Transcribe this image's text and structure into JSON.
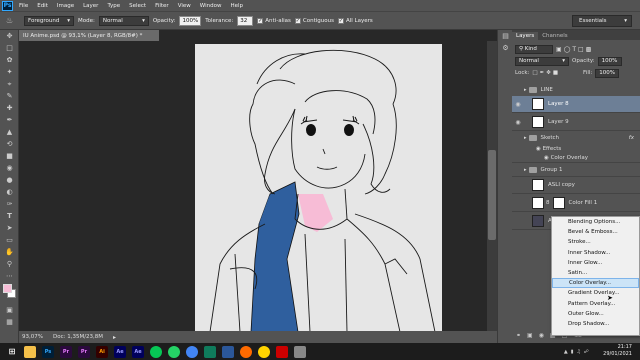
{
  "app": {
    "logo": "Ps"
  },
  "menu": [
    "File",
    "Edit",
    "Image",
    "Layer",
    "Type",
    "Select",
    "Filter",
    "View",
    "Window",
    "Help"
  ],
  "options": {
    "fill_source": "Foreground",
    "mode_label": "Mode:",
    "mode_value": "Normal",
    "opacity_label": "Opacity:",
    "opacity_value": "100%",
    "tolerance_label": "Tolerance:",
    "tolerance_value": "32",
    "antialias": "Anti-alias",
    "contiguous": "Contiguous",
    "all_layers": "All Layers",
    "workspace": "Essentials"
  },
  "document": {
    "tab_title": "IU Anime.psd @ 93,1% (Layer 8, RGB/8#) *",
    "zoom": "93,07%",
    "doc_info": "Doc: 1,35M/23,8M"
  },
  "panel": {
    "tabs": [
      "Layers",
      "Channels"
    ],
    "kind": "Kind",
    "blend": "Normal",
    "opacity_label": "Opacity:",
    "opacity_value": "100%",
    "lock_label": "Lock:",
    "fill_label": "Fill:",
    "fill_value": "100%",
    "layers": [
      {
        "name": "LINE"
      },
      {
        "name": "Layer 8"
      },
      {
        "name": "Layer 9"
      },
      {
        "name": "Sketch"
      },
      {
        "name": "Effects"
      },
      {
        "name": "Color Overlay"
      },
      {
        "name": "Group 1"
      },
      {
        "name": "ASLI copy"
      },
      {
        "name": "Color Fill 1"
      },
      {
        "name": "ASLI"
      }
    ],
    "fx": "fx"
  },
  "context_menu": [
    "Blending Options...",
    "Bevel & Emboss...",
    "Stroke...",
    "Inner Shadow...",
    "Inner Glow...",
    "Satin...",
    "Color Overlay...",
    "Gradient Overlay...",
    "Pattern Overlay...",
    "Outer Glow...",
    "Drop Shadow..."
  ],
  "clock": {
    "time": "21:17",
    "date": "29/01/2021"
  },
  "colors": {
    "accent_blue": "#2f5f9e",
    "pink": "#f7bcd6",
    "highlight": "#cce4f7"
  }
}
